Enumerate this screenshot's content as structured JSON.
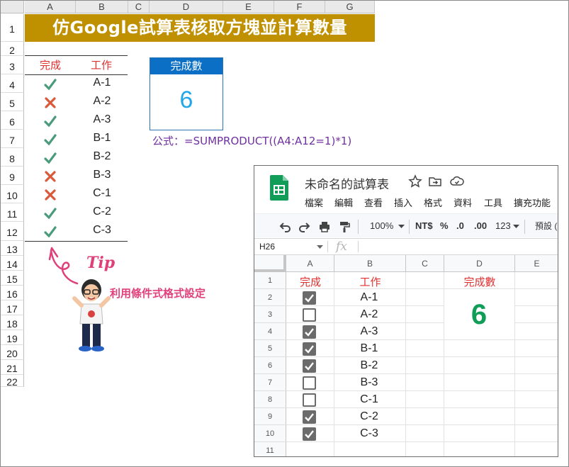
{
  "excel": {
    "columns": [
      "A",
      "B",
      "C",
      "D",
      "E",
      "F",
      "G"
    ],
    "rows": [
      "1",
      "2",
      "3",
      "4",
      "5",
      "6",
      "7",
      "8",
      "9",
      "10",
      "11",
      "12",
      "13",
      "14",
      "15",
      "16",
      "17",
      "18",
      "19",
      "20",
      "21",
      "22"
    ],
    "title": "仿Google試算表核取方塊並計算數量",
    "header_done": "完成",
    "header_task": "工作",
    "items": [
      {
        "done": true,
        "task": "A-1"
      },
      {
        "done": false,
        "task": "A-2"
      },
      {
        "done": true,
        "task": "A-3"
      },
      {
        "done": true,
        "task": "B-1"
      },
      {
        "done": true,
        "task": "B-2"
      },
      {
        "done": false,
        "task": "B-3"
      },
      {
        "done": false,
        "task": "C-1"
      },
      {
        "done": true,
        "task": "C-2"
      },
      {
        "done": true,
        "task": "C-3"
      }
    ],
    "count_label": "完成數",
    "count_value": "6",
    "formula": "公式：=SUMPRODUCT((A4:A12=1)*1)",
    "tip_word": "Tip",
    "tip_note": "利用條件式格式設定",
    "colors": {
      "check": "#4a9a7c",
      "cross": "#d9593a",
      "title_bg": "#bf9000"
    }
  },
  "gsheet": {
    "doc_title": "未命名的試算表",
    "menu": [
      "檔案",
      "編輯",
      "查看",
      "插入",
      "格式",
      "資料",
      "工具",
      "擴充功能"
    ],
    "toolbar": {
      "zoom": "100%",
      "currency": "NT$",
      "percent": "%",
      "dec_less": ".0",
      "dec_more": ".00",
      "more_formats": "123",
      "font": "預設 ("
    },
    "name_box": "H26",
    "fx_label": "fx",
    "columns": [
      "A",
      "B",
      "C",
      "D",
      "E"
    ],
    "rows": [
      "1",
      "2",
      "3",
      "4",
      "5",
      "6",
      "7",
      "8",
      "9",
      "10",
      "11"
    ],
    "header_done": "完成",
    "header_task": "工作",
    "items": [
      {
        "checked": true,
        "task": "A-1"
      },
      {
        "checked": false,
        "task": "A-2"
      },
      {
        "checked": true,
        "task": "A-3"
      },
      {
        "checked": true,
        "task": "B-1"
      },
      {
        "checked": true,
        "task": "B-2"
      },
      {
        "checked": false,
        "task": "B-3"
      },
      {
        "checked": false,
        "task": "C-1"
      },
      {
        "checked": true,
        "task": "C-2"
      },
      {
        "checked": true,
        "task": "C-3"
      }
    ],
    "count_label": "完成數",
    "count_value": "6",
    "colors": {
      "count": "#0f9d58",
      "logo": "#0f9d58"
    }
  }
}
